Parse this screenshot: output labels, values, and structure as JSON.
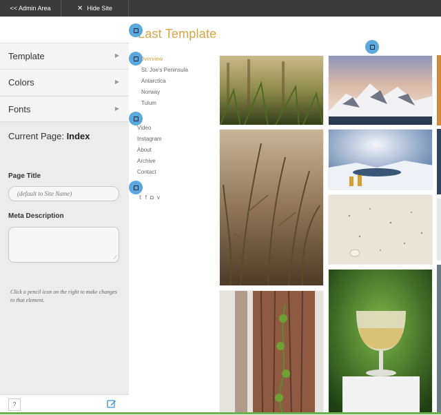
{
  "topbar": {
    "admin_label": "<< Admin Area",
    "hide_icon": "close-icon",
    "hide_label": "Hide Site Builder"
  },
  "sidebar": {
    "items": [
      {
        "label": "Template",
        "icon": "triangle-right-icon"
      },
      {
        "label": "Colors",
        "icon": "triangle-right-icon"
      },
      {
        "label": "Fonts",
        "icon": "triangle-right-icon"
      }
    ],
    "current_page_prefix": "Current Page:",
    "current_page_name": "Index",
    "page_title_label": "Page Title",
    "page_title_placeholder": "(default to Site Name)",
    "meta_description_label": "Meta Description",
    "hint": "Click a pencil icon on the right to make changes to that element.",
    "help_label": "?",
    "footer_icon": "edit-icon"
  },
  "site": {
    "title": "Last Template",
    "title_color": "#d9a441",
    "nav_sub": [
      "Overview",
      "St. Joe's Peninsula",
      "Antarctica",
      "Norway",
      "Tulum"
    ],
    "nav_main": [
      "Video",
      "Instagram",
      "About",
      "Archive",
      "Contact"
    ],
    "social_icons": [
      "twitter-icon",
      "facebook-icon",
      "instagram-icon",
      "vimeo-icon"
    ],
    "pencil_color": "#5aa8dc",
    "photos": [
      "grass-sunset",
      "antarctica-mountains",
      "grass-stalks",
      "antarctica-glacier",
      "sand-shells",
      "tree-bark-vine",
      "wine-glass"
    ]
  }
}
